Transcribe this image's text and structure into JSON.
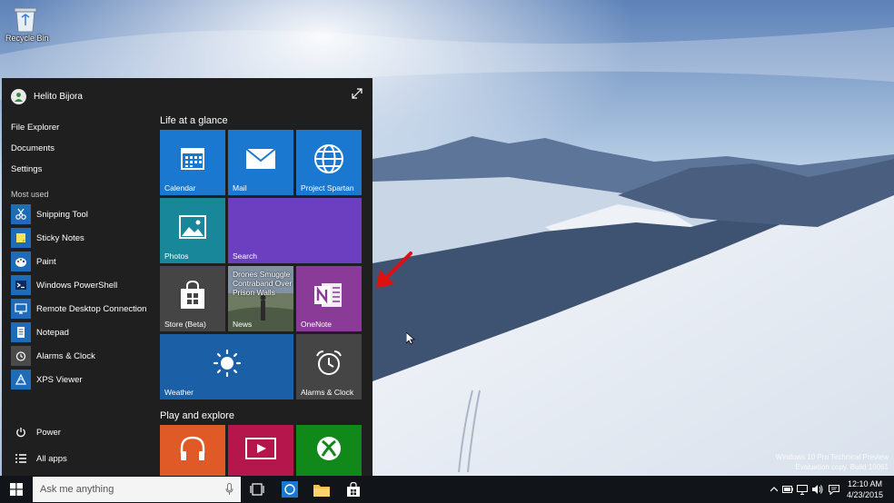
{
  "desktop": {
    "recycle_bin_label": "Recycle Bin",
    "watermark": {
      "line1": "Windows 10 Pro Technical Preview",
      "line2": "Evaluation copy. Build 10061"
    }
  },
  "start_menu": {
    "user_name": "Helito Bijora",
    "links": [
      "File Explorer",
      "Documents",
      "Settings"
    ],
    "most_used_label": "Most used",
    "most_used": [
      {
        "label": "Snipping Tool",
        "icon": "scissors-icon",
        "color": "#1e6bb8"
      },
      {
        "label": "Sticky Notes",
        "icon": "sticky-notes-icon",
        "color": "#1e6bb8"
      },
      {
        "label": "Paint",
        "icon": "paint-icon",
        "color": "#1e6bb8"
      },
      {
        "label": "Windows PowerShell",
        "icon": "powershell-icon",
        "color": "#1e6bb8"
      },
      {
        "label": "Remote Desktop Connection",
        "icon": "remote-desktop-icon",
        "color": "#1e6bb8"
      },
      {
        "label": "Notepad",
        "icon": "notepad-icon",
        "color": "#1e6bb8"
      },
      {
        "label": "Alarms & Clock",
        "icon": "alarm-clock-icon",
        "color": "#4a4a4a"
      },
      {
        "label": "XPS Viewer",
        "icon": "xps-viewer-icon",
        "color": "#1e6bb8"
      }
    ],
    "power_label": "Power",
    "all_apps_label": "All apps",
    "groups": {
      "life": "Life at a glance",
      "play": "Play and explore"
    },
    "tiles": {
      "calendar": "Calendar",
      "mail": "Mail",
      "spartan": "Project Spartan",
      "photos": "Photos",
      "search": "Search",
      "store": "Store (Beta)",
      "news": "News",
      "news_headline": "Drones Smuggle Contraband Over Prison Walls",
      "onenote": "OneNote",
      "weather": "Weather",
      "alarms": "Alarms & Clock"
    }
  },
  "taskbar": {
    "search_placeholder": "Ask me anything",
    "time": "12:10 AM",
    "date": "4/23/2015"
  },
  "colors": {
    "tile_blue": "#1b78d0",
    "tile_purple": "#6b3fbf",
    "tile_teal": "#18879a",
    "tile_onenote": "#8a3a97",
    "tile_orange": "#e05a28",
    "tile_crimson": "#b5164b",
    "tile_green": "#11891a",
    "tile_gray": "#454545"
  }
}
